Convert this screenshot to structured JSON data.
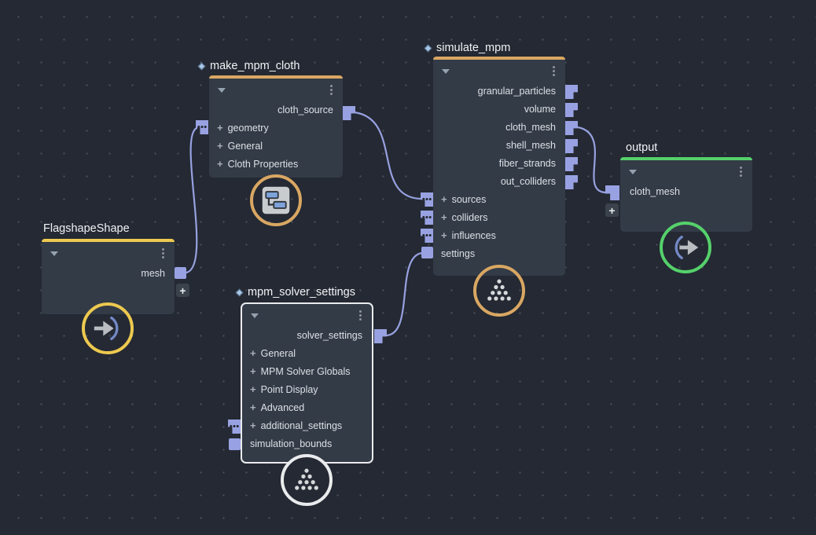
{
  "canvas": {
    "background": "#242933",
    "grid_dot_color": "#4a535f",
    "wire_color": "#97a1e0",
    "port_color": "#98a2e2"
  },
  "colors": {
    "node_body": "#333b47",
    "accent_orange": "#d9a763",
    "accent_yellow": "#edc94f",
    "accent_green": "#55d16b",
    "selection_white": "#e9ebed"
  },
  "icons": {
    "collapse": "triangle-down",
    "node_menu": "vertical-ellipsis",
    "expand_row": "plus",
    "multi_port": "three-dots",
    "add_port": "plus",
    "asset": "diamond"
  },
  "nodes": [
    {
      "title": "FlagshapeShape",
      "accent": "#edc94f",
      "outputs": [
        "mesh"
      ],
      "inputs": [],
      "badge_icon": "arrow-into-arc-icon"
    },
    {
      "title": "make_mpm_cloth",
      "accent": "#d9a763",
      "outputs": [
        "cloth_source"
      ],
      "inputs": [
        "geometry",
        "General",
        "Cloth Properties"
      ],
      "badge_icon": "subnet-icon"
    },
    {
      "title": "simulate_mpm",
      "accent": "#d9a763",
      "outputs": [
        "granular_particles",
        "volume",
        "cloth_mesh",
        "shell_mesh",
        "fiber_strands",
        "out_colliders"
      ],
      "inputs": [
        "sources",
        "colliders",
        "influences",
        "settings"
      ],
      "badge_icon": "particles-icon"
    },
    {
      "title": "mpm_solver_settings",
      "accent": "#e9ebed",
      "selected": true,
      "outputs": [
        "solver_settings"
      ],
      "inputs": [
        "General",
        "MPM Solver Globals",
        "Point Display",
        "Advanced",
        "additional_settings",
        "simulation_bounds"
      ],
      "badge_icon": "particles-icon"
    },
    {
      "title": "output",
      "accent": "#55d16b",
      "outputs": [],
      "inputs": [
        "cloth_mesh"
      ],
      "badge_icon": "arrow-out-of-arc-icon"
    }
  ]
}
